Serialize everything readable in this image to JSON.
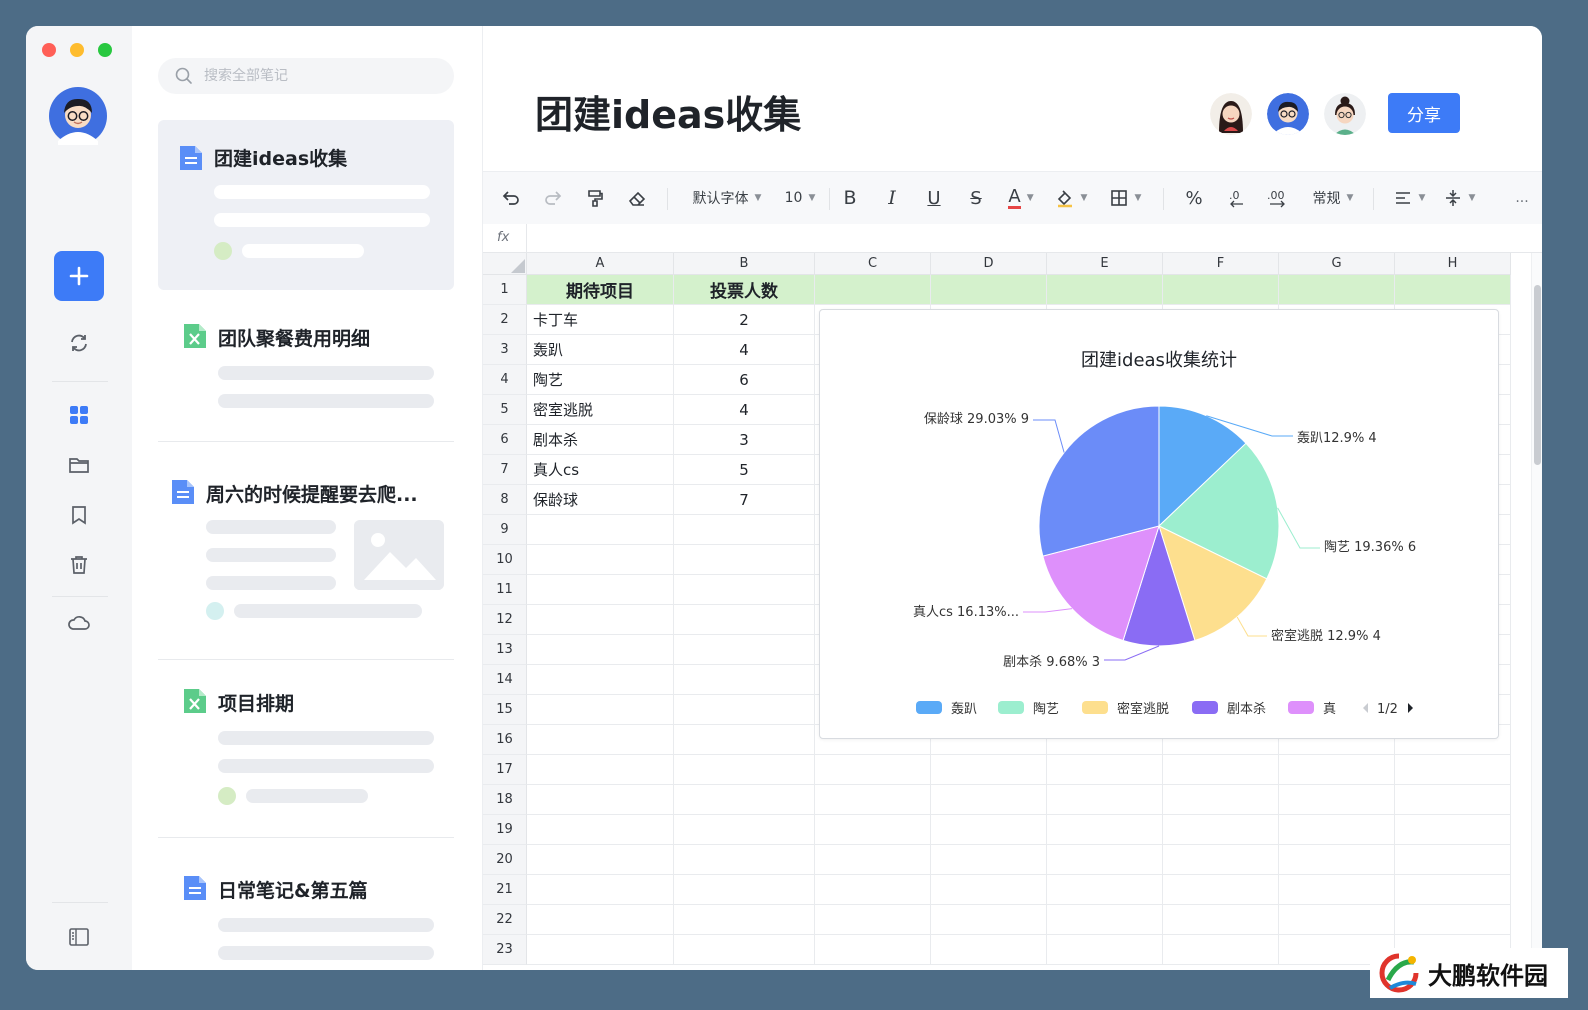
{
  "sidebar": {
    "icons": [
      "add-icon",
      "sync-icon",
      "grid-icon",
      "folder-icon",
      "bookmark-icon",
      "trash-icon",
      "cloud-icon",
      "panel-toggle-icon"
    ]
  },
  "notes": {
    "search_placeholder": "搜索全部笔记",
    "items": [
      {
        "title": "团建ideas收集",
        "type": "doc"
      },
      {
        "title": "团队聚餐费用明细",
        "type": "sheet"
      },
      {
        "title": "周六的时候提醒要去爬...",
        "type": "doc"
      },
      {
        "title": "项目排期",
        "type": "sheet"
      },
      {
        "title": "日常笔记&第五篇",
        "type": "doc"
      }
    ]
  },
  "document": {
    "title": "团建ideas收集",
    "share_label": "分享"
  },
  "toolbar": {
    "font": "默认字体",
    "size": "10",
    "bold": "B",
    "italic": "I",
    "underline": "U",
    "strike": "S",
    "font_color": "A",
    "percent": "%",
    "number_format": "常规",
    "more": "..."
  },
  "formula_bar": {
    "label": "fx",
    "value": ""
  },
  "sheet": {
    "columns": [
      "A",
      "B",
      "C",
      "D",
      "E",
      "F",
      "G",
      "H"
    ],
    "row_numbers": [
      "1",
      "2",
      "3",
      "4",
      "5",
      "6",
      "7",
      "8",
      "9",
      "10",
      "11",
      "12",
      "13",
      "14",
      "15",
      "16",
      "17",
      "18",
      "19",
      "20",
      "21",
      "22",
      "23"
    ],
    "header": [
      "期待项目",
      "投票人数"
    ],
    "rows": [
      [
        "卡丁车",
        "2"
      ],
      [
        "轰趴",
        "4"
      ],
      [
        "陶艺",
        "6"
      ],
      [
        "密室逃脱",
        "4"
      ],
      [
        "剧本杀",
        "3"
      ],
      [
        "真人cs",
        "5"
      ],
      [
        "保龄球",
        "7"
      ]
    ]
  },
  "chart_data": {
    "type": "pie",
    "title": "团建ideas收集统计",
    "slices": [
      {
        "name": "轰趴",
        "value": 4,
        "label": "轰趴12.9% 4",
        "color": "#5aaaf7"
      },
      {
        "name": "陶艺",
        "value": 6,
        "label": "陶艺 19.36% 6",
        "color": "#9ceecf"
      },
      {
        "name": "密室逃脱",
        "value": 4,
        "label": "密室逃脱 12.9% 4",
        "color": "#fddf8e"
      },
      {
        "name": "剧本杀",
        "value": 3,
        "label": "剧本杀 9.68% 3",
        "color": "#8a6cf4"
      },
      {
        "name": "真人cs",
        "value": 5,
        "label": "真人cs 16.13%...",
        "color": "#de90fb"
      },
      {
        "name": "保龄球",
        "value": 9,
        "label": "保龄球 29.03% 9",
        "color": "#6b8cf8"
      }
    ],
    "legend": [
      "轰趴",
      "陶艺",
      "密室逃脱",
      "剧本杀",
      "真"
    ],
    "legend_page": "1/2",
    "legend_position": "bottom"
  },
  "watermark": {
    "text": "大鹏软件园"
  },
  "colors": {
    "accent": "#3d7bf7",
    "header_fill": "#d4f1cc"
  }
}
